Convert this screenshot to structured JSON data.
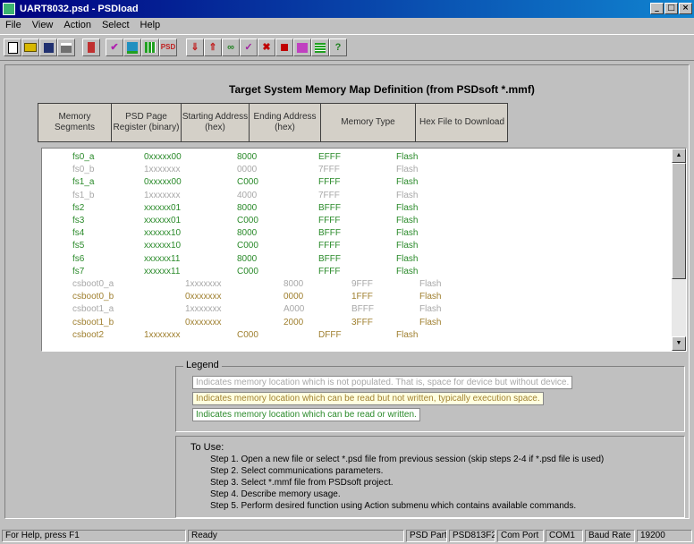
{
  "window": {
    "title": "UART8032.psd - PSDload"
  },
  "menu": [
    "File",
    "View",
    "Action",
    "Select",
    "Help"
  ],
  "toolbar": {
    "icons": [
      "new-file-icon",
      "open-folder-icon",
      "save-icon",
      "print-icon",
      "chip-icon",
      "check-icon",
      "chart-icon",
      "grid-icon",
      "psd-icon",
      "download-icon",
      "upload-icon",
      "erase-icon",
      "verify-icon",
      "cancel-icon",
      "stop-icon",
      "config-icon",
      "memmap-icon",
      "help-icon"
    ]
  },
  "map": {
    "title": "Target System Memory Map Definition (from PSDsoft *.mmf)",
    "headers": {
      "segments": "Memory Segments",
      "page": "PSD Page Register (binary)",
      "start": "Starting Address (hex)",
      "end": "Ending Address (hex)",
      "type": "Memory Type",
      "hex": "Hex File to Download"
    },
    "rows": [
      {
        "seg": "fs0_a",
        "page": "0xxxxx00",
        "start": "8000",
        "end": "EFFF",
        "type": "Flash",
        "style": "g"
      },
      {
        "seg": "fs0_b",
        "page": "1xxxxxxx",
        "start": "0000",
        "end": "7FFF",
        "type": "Flash",
        "style": "gy"
      },
      {
        "seg": "fs1_a",
        "page": "0xxxxx00",
        "start": "C000",
        "end": "FFFF",
        "type": "Flash",
        "style": "g"
      },
      {
        "seg": "fs1_b",
        "page": "1xxxxxxx",
        "start": "4000",
        "end": "7FFF",
        "type": "Flash",
        "style": "gy"
      },
      {
        "seg": "fs2",
        "page": "xxxxxx01",
        "start": "8000",
        "end": "BFFF",
        "type": "Flash",
        "style": "g"
      },
      {
        "seg": "fs3",
        "page": "xxxxxx01",
        "start": "C000",
        "end": "FFFF",
        "type": "Flash",
        "style": "g"
      },
      {
        "seg": "fs4",
        "page": "xxxxxx10",
        "start": "8000",
        "end": "BFFF",
        "type": "Flash",
        "style": "g"
      },
      {
        "seg": "fs5",
        "page": "xxxxxx10",
        "start": "C000",
        "end": "FFFF",
        "type": "Flash",
        "style": "g"
      },
      {
        "seg": "fs6",
        "page": "xxxxxx11",
        "start": "8000",
        "end": "BFFF",
        "type": "Flash",
        "style": "g"
      },
      {
        "seg": "fs7",
        "page": "xxxxxx11",
        "start": "C000",
        "end": "FFFF",
        "type": "Flash",
        "style": "g"
      },
      {
        "seg": "csboot0_a",
        "page": "1xxxxxxx",
        "start": "8000",
        "end": "9FFF",
        "type": "Flash",
        "style": "gy",
        "shift": true
      },
      {
        "seg": "csboot0_b",
        "page": "0xxxxxxx",
        "start": "0000",
        "end": "1FFF",
        "type": "Flash",
        "style": "o",
        "shift": true
      },
      {
        "seg": "csboot1_a",
        "page": "1xxxxxxx",
        "start": "A000",
        "end": "BFFF",
        "type": "Flash",
        "style": "gy",
        "shift": true
      },
      {
        "seg": "csboot1_b",
        "page": "0xxxxxxx",
        "start": "2000",
        "end": "3FFF",
        "type": "Flash",
        "style": "o",
        "shift": true
      },
      {
        "seg": "csboot2",
        "page": "1xxxxxxx",
        "start": "C000",
        "end": "DFFF",
        "type": "Flash",
        "style": "o"
      }
    ]
  },
  "legend": {
    "title": "Legend",
    "items": [
      {
        "text": "Indicates memory location which is not populated. That is, space for device but without device.",
        "bg": "#ffffff",
        "fg": "#a8a8a8"
      },
      {
        "text": "Indicates memory location which can be read but not written, typically execution space.",
        "bg": "#ffffe0",
        "fg": "#a08030"
      },
      {
        "text": "Indicates memory location which can be read or written.",
        "bg": "#ffffff",
        "fg": "#2a8a2a"
      }
    ]
  },
  "usage": {
    "title": "To Use:",
    "steps": [
      "Step 1. Open a new file or select *.psd file from previous session (skip steps 2-4 if *.psd file is used)",
      "Step 2. Select communications parameters.",
      "Step 3. Select *.mmf file from PSDsoft project.",
      "Step 4. Describe memory usage.",
      "Step 5. Perform desired function using Action submenu which contains available commands."
    ]
  },
  "status": {
    "help": "For Help, press F1",
    "ready": "Ready",
    "psd_part_label": "PSD Part",
    "psd_part": "PSD813F2",
    "com_port_label": "Com Port",
    "com_port": "COM1",
    "baud_label": "Baud Rate",
    "baud": "19200"
  }
}
